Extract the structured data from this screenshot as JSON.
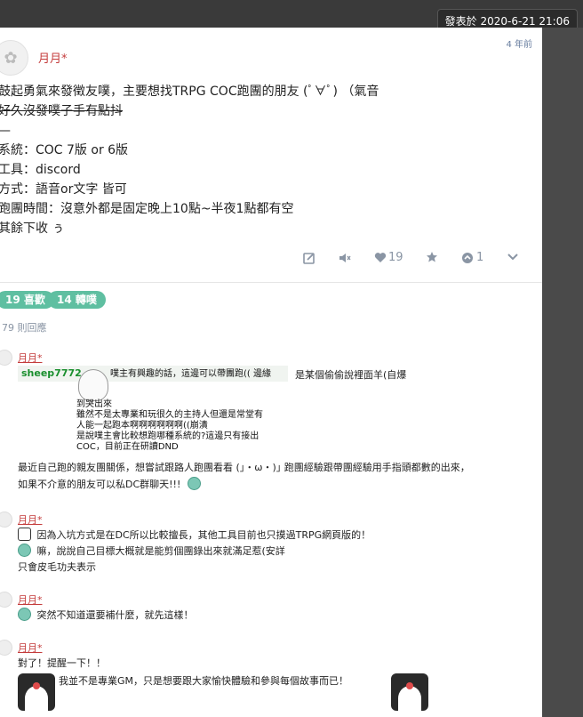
{
  "tooltip": {
    "text": "發表於 2020-6-21 21:06"
  },
  "post": {
    "author": "月月*",
    "time_ago": "4 年前",
    "lines": [
      "鼓起勇氣來發徵友噗，主要想找TRPG COC跑團的朋友 (ﾟ∀ﾟ) （氣音",
      "好久沒發噗子手有點抖",
      "—",
      "系統：COC 7版 or 6版",
      "工具：discord",
      "方式：語音or文字 皆可",
      "跑團時間：沒意外都是固定晚上10點~半夜1點都有空",
      "其餘下收 ぅ"
    ],
    "like_count": "19",
    "replurk_count": "1"
  },
  "badges": {
    "likes": "19 喜歡",
    "replurks": "14 轉噗"
  },
  "reply_count": "79 則回應",
  "comments": [
    {
      "author": "月月*",
      "quote": {
        "username": "sheep7772",
        "lines": [
          "噗主有興趣的話，這邊可以帶團跑(( 邊緣",
          "到哭出來",
          "雖然不是太專業和玩很久的主持人但還是常堂有",
          "人能一起跑本啊啊啊啊啊啊((崩潰",
          "是說噗主會比較想跑哪種系統的?這邊只有接出",
          "COC，目前正在研讀DND"
        ],
        "side": "是某個偷偷說裡面羊(自爆"
      },
      "lines": [
        "最近自己跑的親友團關係，想嘗試跟路人跑團看看 (｣・ω・)｣ 跑團經驗跟帶團經驗用手指頭都數的出來，",
        "如果不介意的朋友可以私DC群聊天!!!"
      ]
    },
    {
      "author": "月月*",
      "lines": [
        "因為入坑方式是在DC所以比較擅長，其他工具目前也只摸過TRPG網頁版的！",
        "嘛，說說自己目標大概就是能剪個團錄出來就滿足惹(安詳",
        "只會皮毛功夫表示"
      ]
    },
    {
      "author": "月月*",
      "lines": [
        "突然不知道還要補什麼，就先這樣！"
      ]
    },
    {
      "author": "月月*",
      "lines": [
        "對了！提醒一下！！",
        "我並不是專業GM，只是想要跟大家愉快體驗和參與每個故事而已！"
      ]
    }
  ],
  "colors": {
    "author": "#c43c3c",
    "badge": "#5fbfa1",
    "meta": "#8a95a4"
  },
  "icons": [
    "edit-icon",
    "mute-icon",
    "heart-icon",
    "star-icon",
    "replurk-icon",
    "chevron-down-icon"
  ]
}
